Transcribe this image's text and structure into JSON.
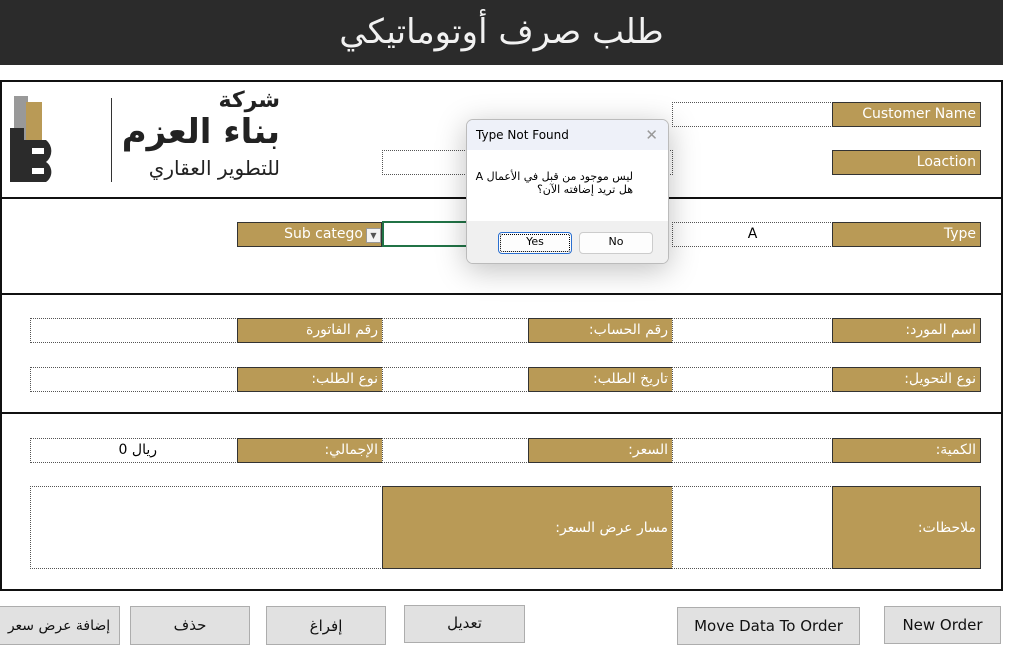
{
  "title": "طلب صرف أوتوماتيكي",
  "logo": {
    "line1": "شركة",
    "line2": "بناء العزم",
    "line3": "للتطوير العقاري"
  },
  "header": {
    "customer_name_label": "Customer Name",
    "location_label": "Loaction",
    "type_label": "Type",
    "type_value": "A",
    "subcategory_label": "Sub catego"
  },
  "fields": {
    "supplier_name": "اسم المورد:",
    "account_number": "رقم الحساب:",
    "invoice_number": "رقم الفاتورة",
    "transfer_type": "نوع التحويل:",
    "request_date": "تاريخ الطلب:",
    "request_type": "نوع الطلب:",
    "quantity": "الكمية:",
    "price": "السعر:",
    "total": "الإجمالي:",
    "total_value": "ريال  0",
    "notes": "ملاحظات:",
    "quote_path": "مسار عرض السعر:"
  },
  "buttons": {
    "new_order": "New Order",
    "move_data": "Move Data To Order",
    "edit": "تعديل",
    "clear": "إفراغ",
    "delete": "حذف",
    "add_quote": "إضافة عرض سعر"
  },
  "dialog": {
    "title": "Type Not Found",
    "line1": "ليس موجود من قبل في الأعمال  A",
    "line2": "هل تريد إضافته الآن؟",
    "yes": "Yes",
    "no": "No"
  },
  "colors": {
    "gold": "#b99a56",
    "titlebar": "#2b2b2b"
  }
}
